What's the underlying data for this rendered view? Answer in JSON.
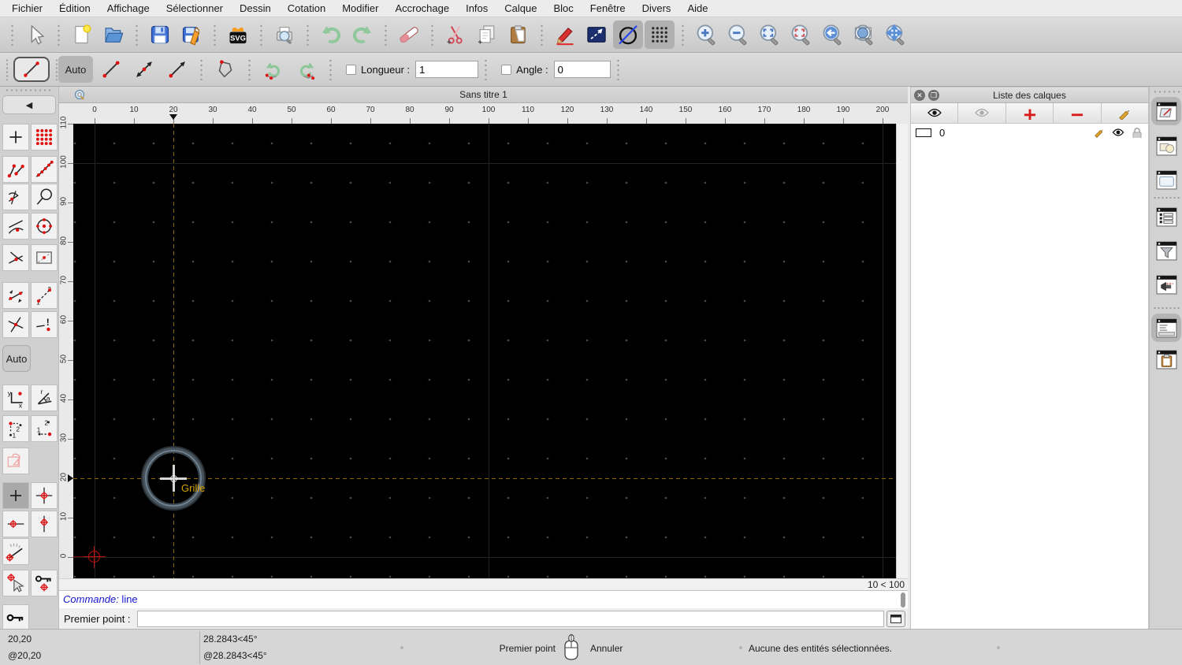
{
  "menu_bar": {
    "items": [
      "Fichier",
      "Édition",
      "Affichage",
      "Sélectionner",
      "Dessin",
      "Cotation",
      "Modifier",
      "Accrochage",
      "Infos",
      "Calque",
      "Bloc",
      "Fenêtre",
      "Divers",
      "Aide"
    ]
  },
  "main_toolbar": {
    "groups": [
      {
        "icons": [
          "selection-arrow"
        ]
      },
      {
        "icons": [
          "new-document",
          "open-file"
        ]
      },
      {
        "icons": [
          "save",
          "save-as"
        ]
      },
      {
        "icons": [
          "export-svg"
        ]
      },
      {
        "icons": [
          "print-preview"
        ]
      },
      {
        "icons": [
          "undo",
          "redo"
        ]
      },
      {
        "icons": [
          "delete-eraser"
        ]
      },
      {
        "icons": [
          "cut",
          "copy",
          "paste"
        ]
      },
      {
        "icons": [
          "draft-pen",
          "select-window",
          "draft-mode",
          "grid-toggle"
        ],
        "active": [
          "draft-mode",
          "grid-toggle"
        ]
      },
      {
        "icons": [
          "zoom-in",
          "zoom-out",
          "zoom-auto",
          "zoom-redraw",
          "zoom-previous",
          "zoom-window",
          "zoom-pan"
        ]
      }
    ]
  },
  "tool_options": {
    "current_tool_icon": "line-2p",
    "auto_label": "Auto",
    "mode_icons": [
      "line-2p",
      "line-both-arrows",
      "line-arrow"
    ],
    "polyline_icon": "close-polyline",
    "segment_icons": [
      "undo-segment",
      "redo-segment"
    ],
    "length_label": "Longueur :",
    "length_value": "1",
    "angle_label": "Angle :",
    "angle_value": "0"
  },
  "snap_toolbar": {
    "auto_label": "Auto",
    "selected": "restrict-nothing",
    "rows": [
      {
        "icons": [
          "snap-free",
          "snap-grid"
        ]
      },
      {
        "icons": [
          "snap-endpoints",
          "snap-on-entity"
        ]
      },
      {
        "icons": [
          "snap-perpendicular",
          "snap-on-circle"
        ]
      },
      {
        "icons": [
          "snap-tangent",
          "snap-center"
        ]
      },
      {
        "icons": [
          "snap-middle",
          "snap-reference"
        ]
      },
      {
        "icons": [
          "snap-distance-1",
          "snap-distance-2"
        ]
      },
      {
        "icons": [
          "snap-intersection",
          "snap-intersection-manual"
        ]
      },
      {
        "icons": [
          "coord-cartesian",
          "coord-polar"
        ]
      },
      {
        "icons": [
          "rel-cartesian",
          "rel-polar"
        ]
      },
      {
        "icons": [
          "select-order"
        ]
      },
      {
        "icons": [
          "restrict-nothing",
          "restrict-orthogonal"
        ]
      },
      {
        "icons": [
          "restrict-horizontal",
          "restrict-vertical"
        ]
      },
      {
        "icons": [
          "snap-angle"
        ]
      },
      {
        "icons": [
          "set-relative-zero",
          "lock-relative-zero"
        ]
      },
      {
        "icons": [
          "relative-zero-key"
        ]
      }
    ]
  },
  "drawing": {
    "title": "Sans titre 1",
    "ruler_h_labels": [
      "0",
      "10",
      "20",
      "30",
      "40",
      "50",
      "60",
      "70",
      "80",
      "90",
      "100",
      "110",
      "120",
      "130",
      "140",
      "150",
      "160",
      "170",
      "180",
      "190",
      "200"
    ],
    "ruler_v_labels": [
      "0",
      "10",
      "20",
      "30",
      "40",
      "50",
      "60",
      "70",
      "80",
      "90",
      "100",
      "110"
    ],
    "snap_tooltip": "Grille",
    "grid_status": "10 < 100",
    "cursor_position": {
      "x": "20",
      "y": "20"
    }
  },
  "command": {
    "history_label": "Commande:",
    "history_value": " line",
    "prompt_label": "Premier point :",
    "input_value": ""
  },
  "layers_panel": {
    "title": "Liste des calques",
    "toolbar_icons": [
      "show-all-layers",
      "hide-all-layers",
      "add-layer",
      "remove-layer",
      "edit-layer"
    ],
    "layers": [
      {
        "name": "0",
        "row_icons": [
          "layer-edit",
          "layer-visible",
          "layer-lock"
        ]
      }
    ]
  },
  "right_dock": {
    "icons": [
      "dock-layer-list",
      "dock-block-list",
      "dock-library-browser",
      "dock-entity-list",
      "dock-filter",
      "dock-console",
      "dock-command-line",
      "dock-clipboard"
    ],
    "active": [
      "dock-layer-list",
      "dock-command-line"
    ]
  },
  "status_bar": {
    "abs_coord": "20,20",
    "rel_coord": "@20,20",
    "abs_polar": "28.2843<45°",
    "rel_polar": "@28.2843<45°",
    "left_mouse_label": "Premier point",
    "right_mouse_label": "Annuler",
    "selection_status": "Aucune des entités sélectionnées."
  },
  "colors": {
    "command_blue": "#1414cc",
    "snap_label_yellow": "#d4a300",
    "crosshair_orange": "#8d6a0d",
    "origin_red": "#c01010",
    "canvas_black": "#000000"
  }
}
